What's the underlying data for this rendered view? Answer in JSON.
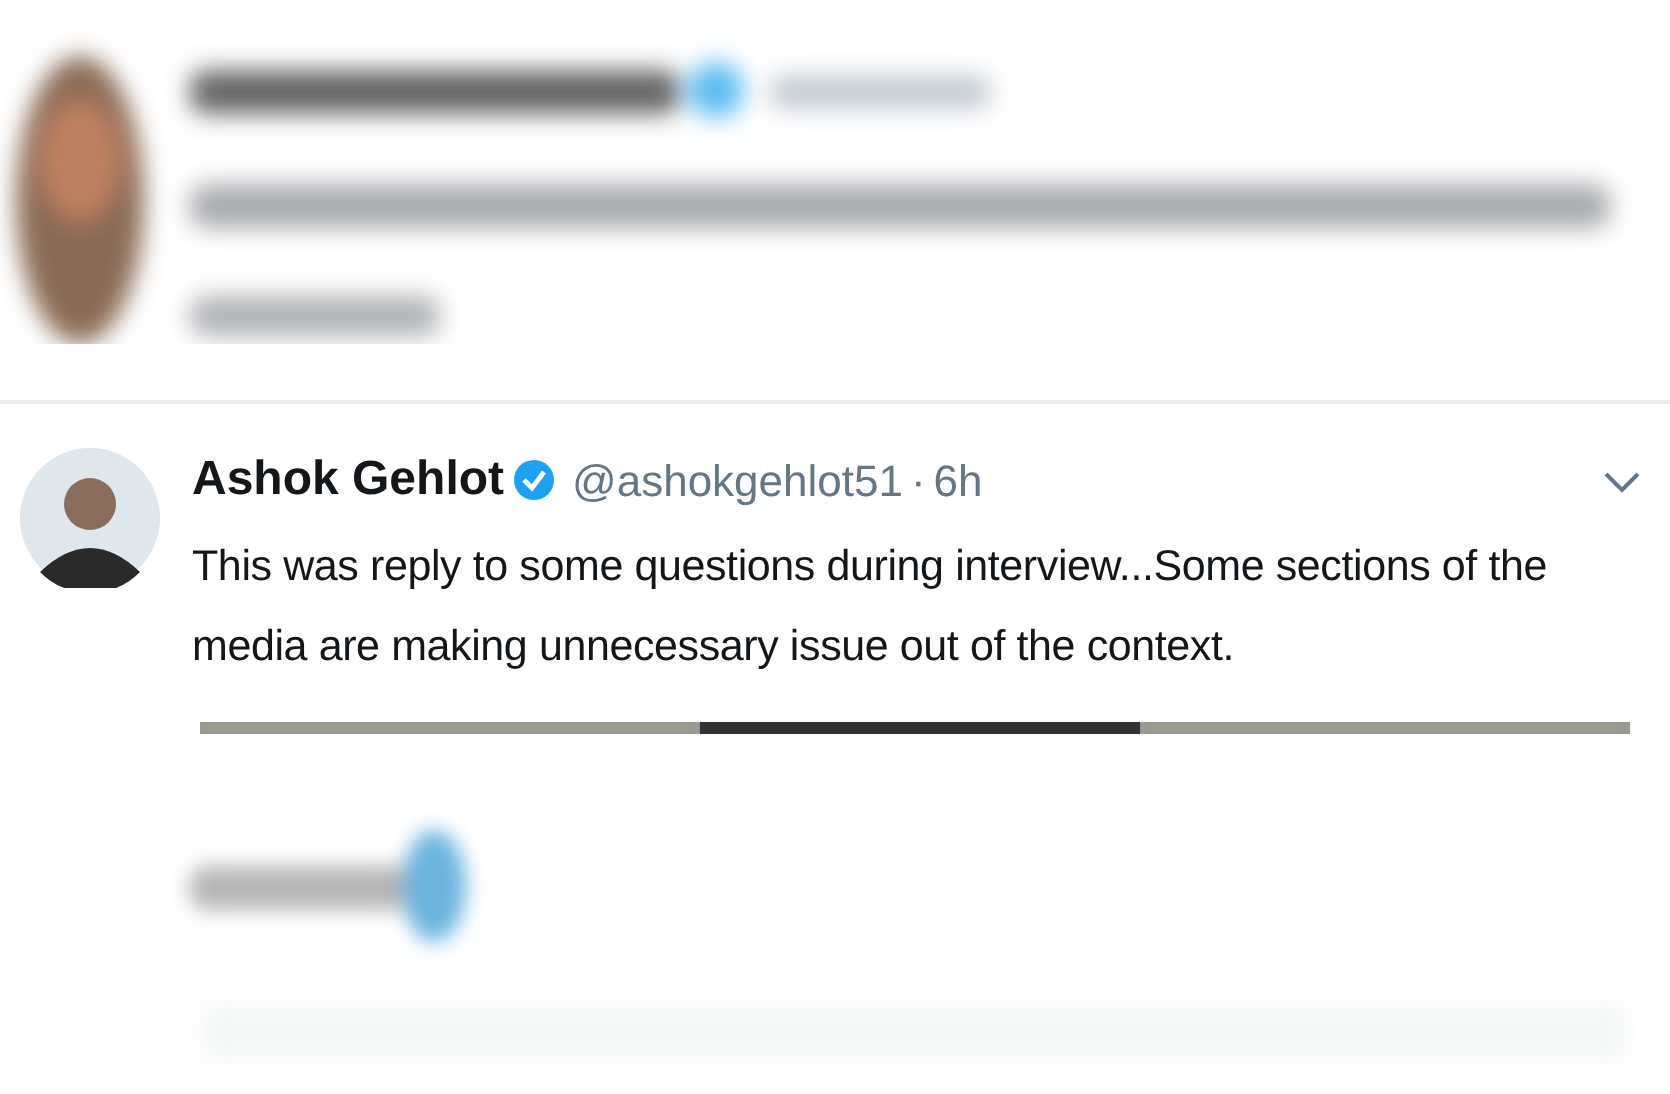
{
  "tweet": {
    "author": "Ashok Gehlot",
    "verified": true,
    "handle": "@ashokgehlot51",
    "separator": "·",
    "time": "6h",
    "text": "This was reply to some questions during interview...Some sections of the media are making unnecessary issue out of the context."
  }
}
